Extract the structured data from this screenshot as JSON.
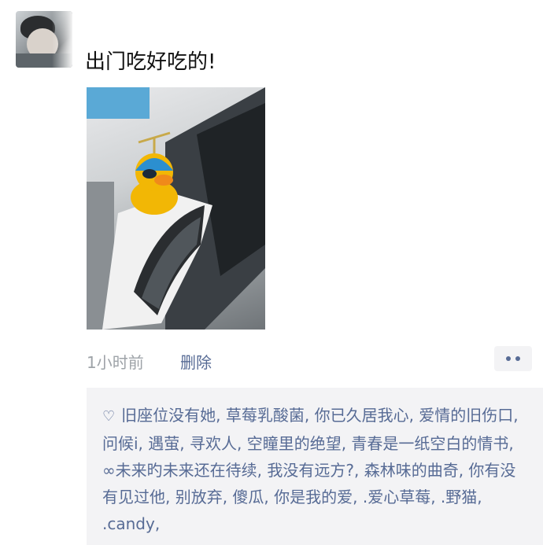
{
  "post": {
    "text": "出门吃好吃的!",
    "time": "1小时前",
    "delete_label": "删除"
  },
  "likes": {
    "names_text": "旧座位没有她, 草莓乳酸菌, 你已久居我心, 爱情的旧伤口, 问候i, 遇萤, 寻欢人, 空瞳里的绝望, 青春是一纸空白的情书, ∞未来旳未来还在待续, 我没有远方?, 森林味的曲奇, 你有没有见过他, 别放弃, 傻瓜, 你是我的爱, .爱心草莓, .野猫, .candy,"
  },
  "icons": {
    "like": "heart-outline-icon",
    "more": "more-dots-icon"
  },
  "colors": {
    "link": "#576b95",
    "timestamp": "#9ea3a8",
    "likes_bg": "#f3f3f5"
  }
}
